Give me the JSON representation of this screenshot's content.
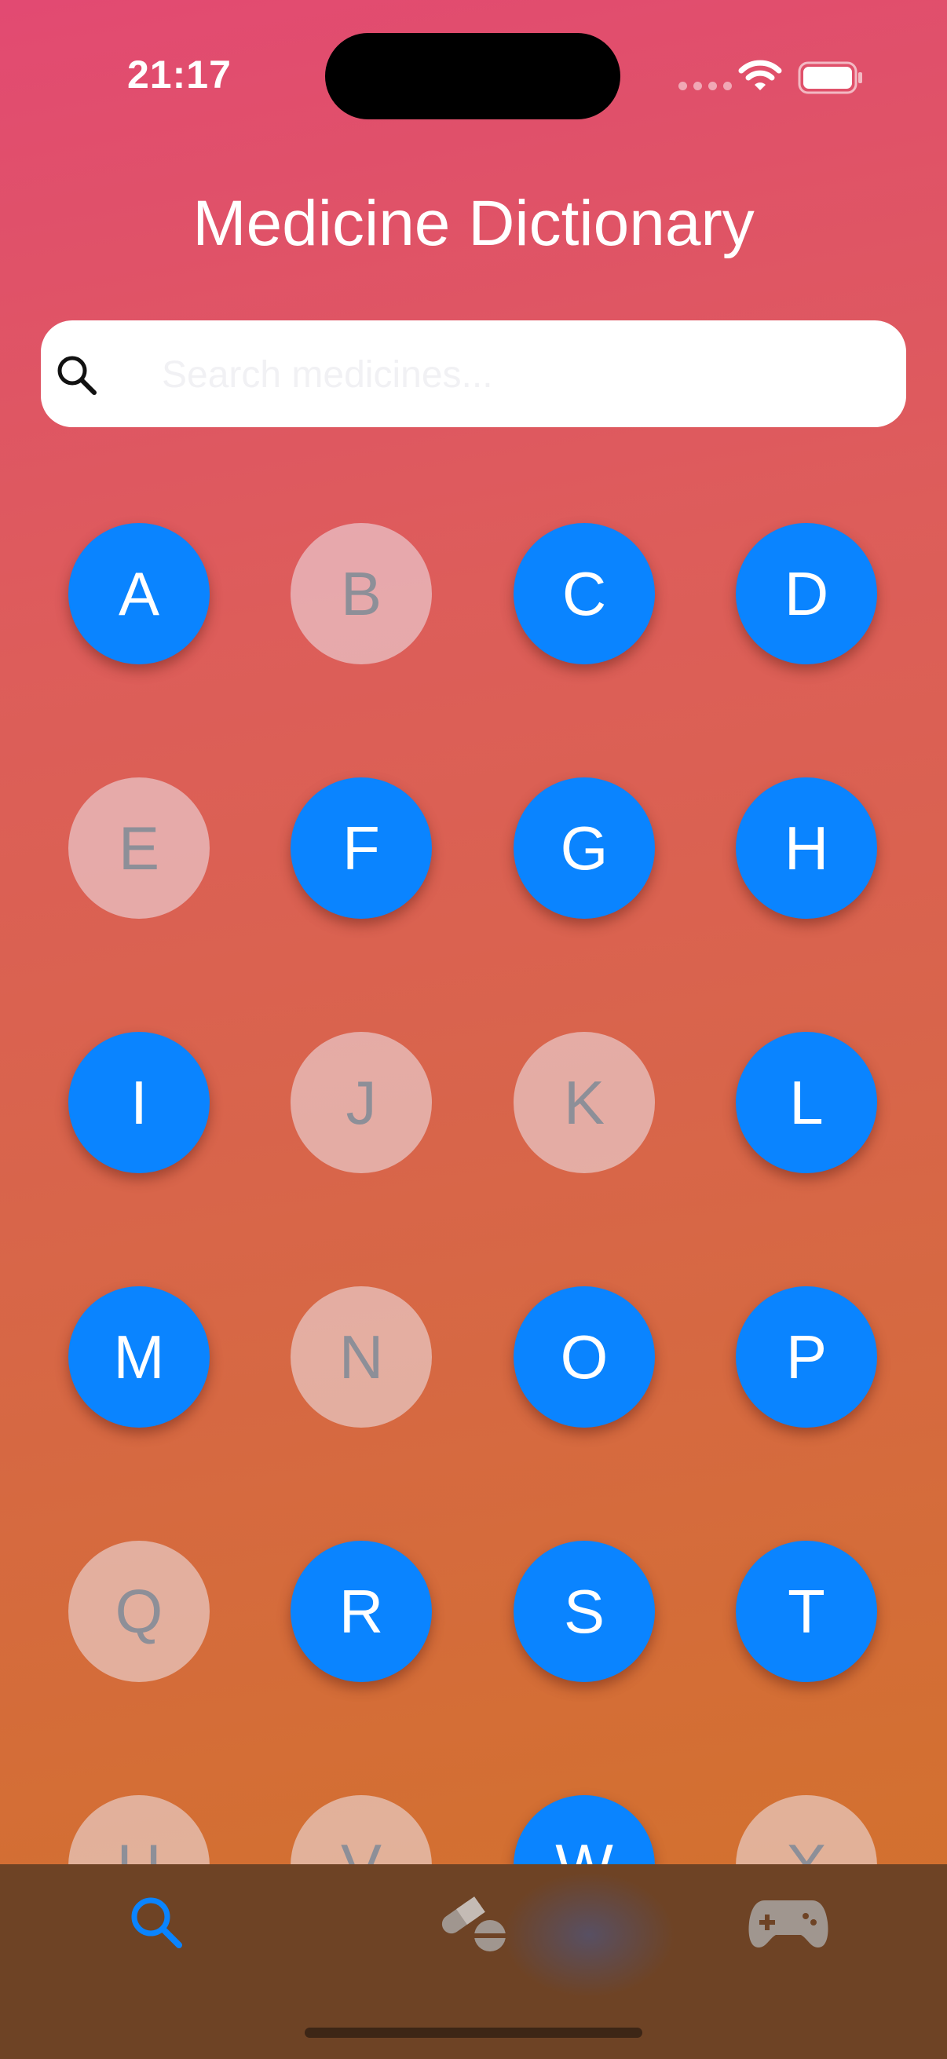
{
  "status_bar": {
    "time": "21:17"
  },
  "header": {
    "title": "Medicine Dictionary"
  },
  "search": {
    "placeholder": "Search medicines..."
  },
  "letters": [
    {
      "label": "A",
      "available": true
    },
    {
      "label": "B",
      "available": false
    },
    {
      "label": "C",
      "available": true
    },
    {
      "label": "D",
      "available": true
    },
    {
      "label": "E",
      "available": false
    },
    {
      "label": "F",
      "available": true
    },
    {
      "label": "G",
      "available": true
    },
    {
      "label": "H",
      "available": true
    },
    {
      "label": "I",
      "available": true
    },
    {
      "label": "J",
      "available": false
    },
    {
      "label": "K",
      "available": false
    },
    {
      "label": "L",
      "available": true
    },
    {
      "label": "M",
      "available": true
    },
    {
      "label": "N",
      "available": false
    },
    {
      "label": "O",
      "available": true
    },
    {
      "label": "P",
      "available": true
    },
    {
      "label": "Q",
      "available": false
    },
    {
      "label": "R",
      "available": true
    },
    {
      "label": "S",
      "available": true
    },
    {
      "label": "T",
      "available": true
    },
    {
      "label": "U",
      "available": false
    },
    {
      "label": "V",
      "available": false
    },
    {
      "label": "W",
      "available": true
    },
    {
      "label": "X",
      "available": false
    }
  ],
  "tabs": [
    {
      "icon": "search-icon",
      "active": true
    },
    {
      "icon": "pills-icon",
      "active": false
    },
    {
      "icon": "gamepad-icon",
      "active": false
    }
  ],
  "colors": {
    "accent": "#0a84ff",
    "inactive_tab": "#a0968f",
    "disabled_letter_text": "#8d8f98"
  }
}
